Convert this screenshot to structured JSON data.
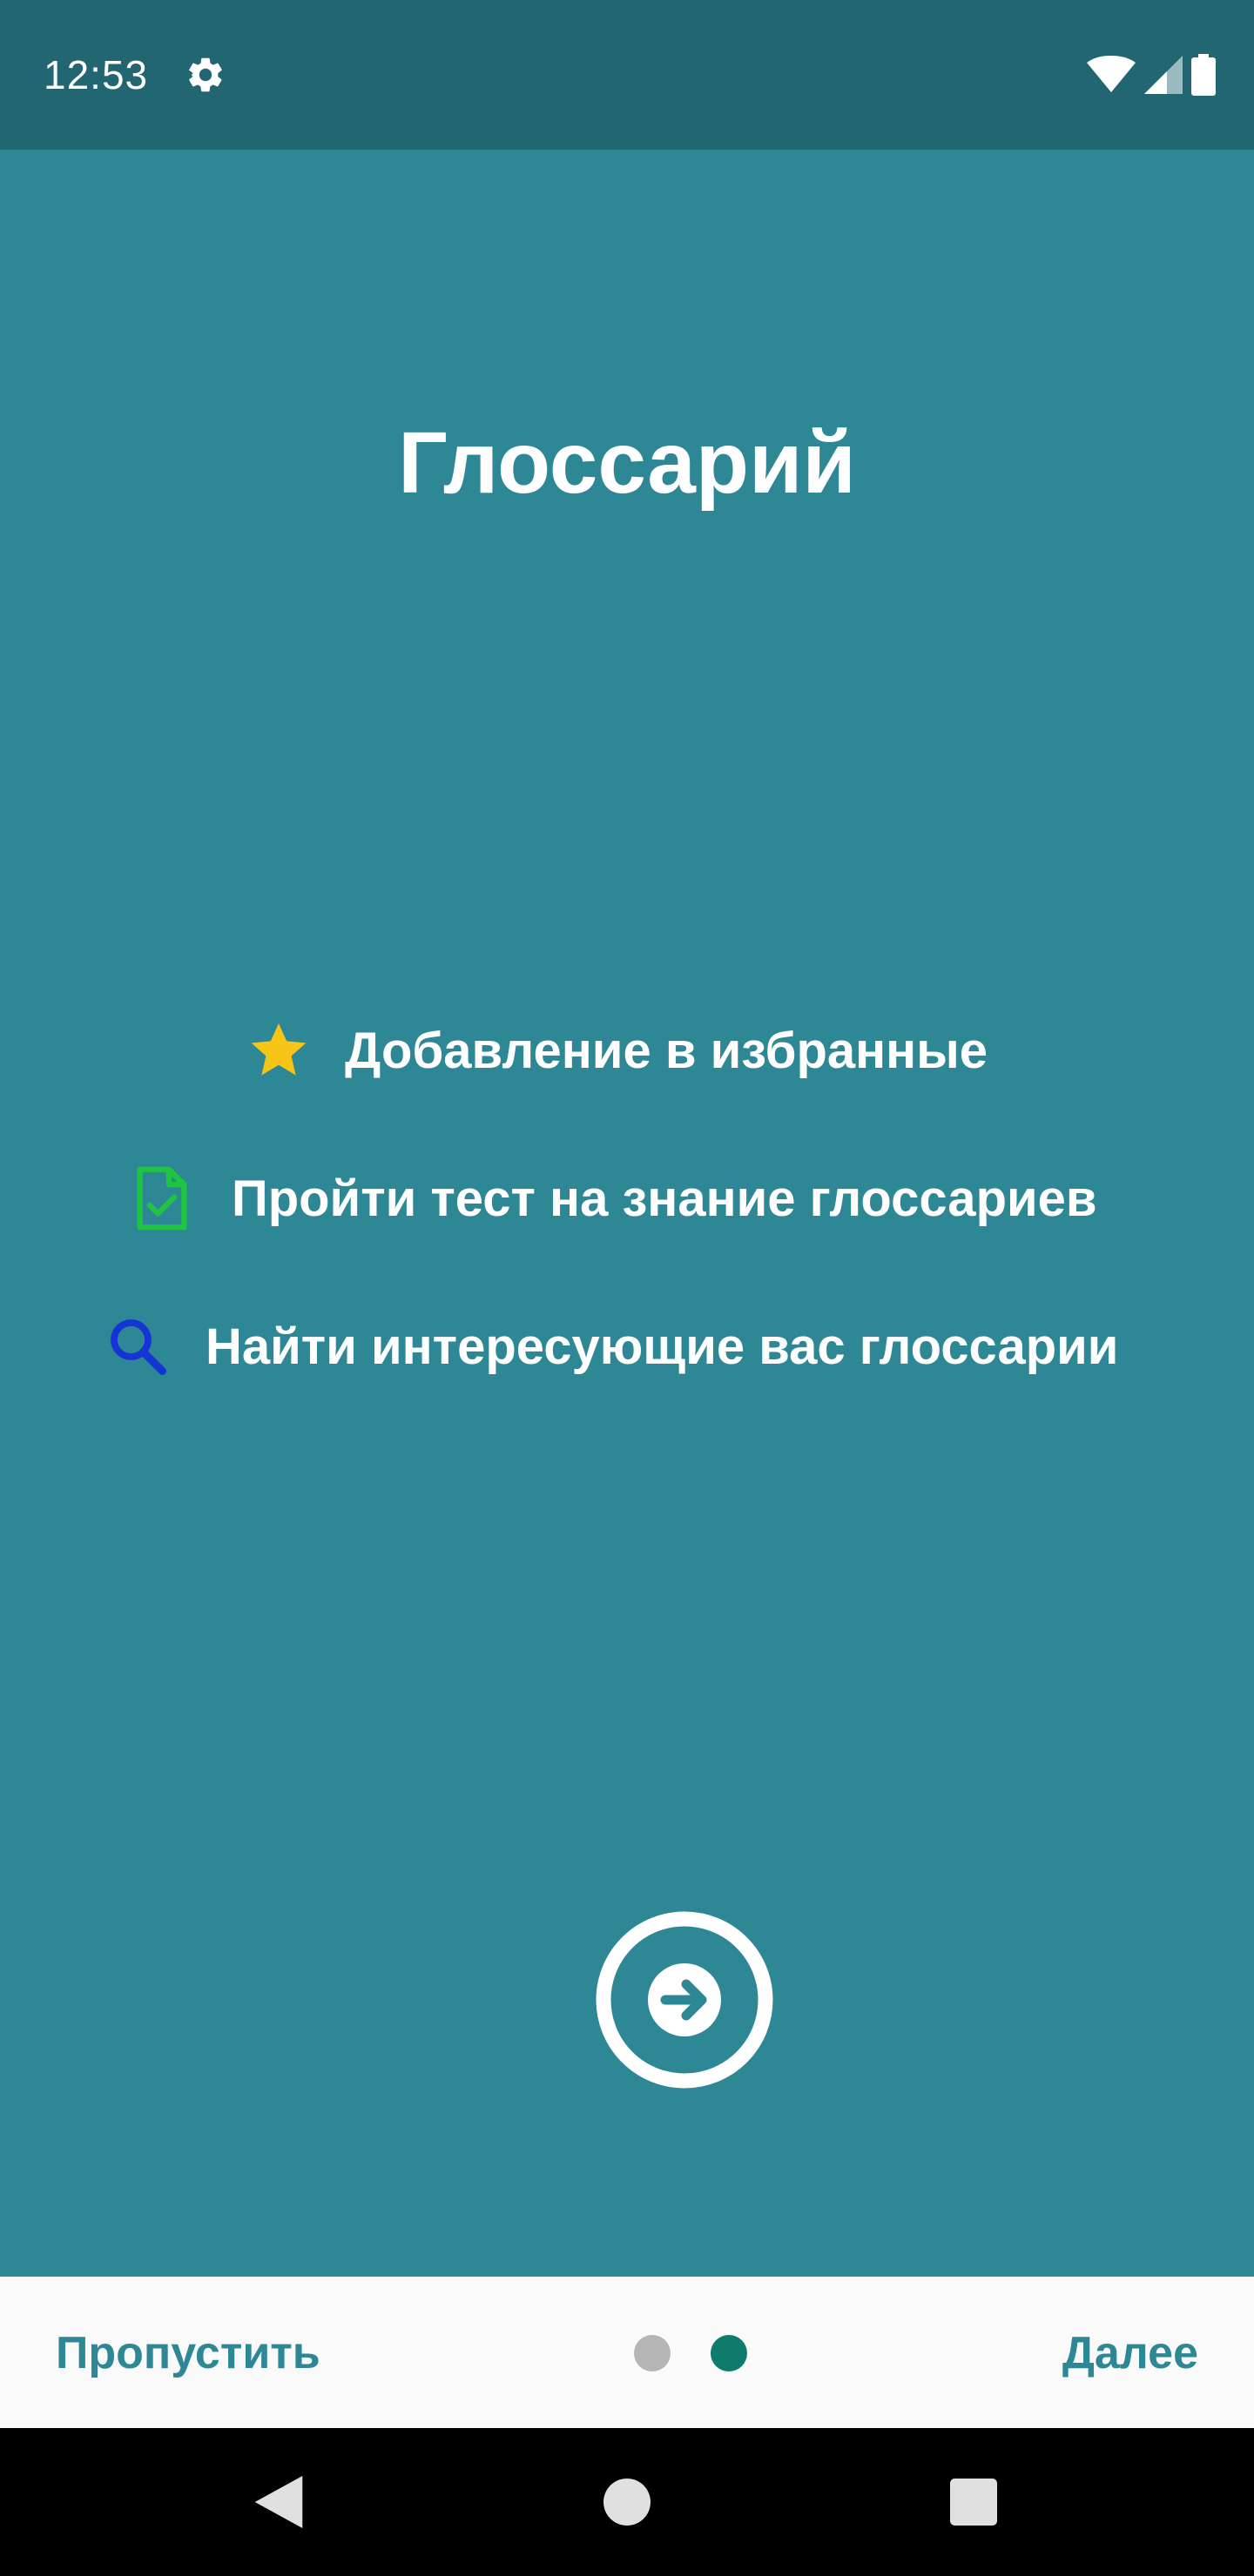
{
  "status_bar": {
    "time": "12:53",
    "icons": [
      "settings-gear-icon",
      "wifi-icon",
      "cell-signal-icon",
      "battery-icon"
    ]
  },
  "onboarding": {
    "title": "Глоссарий",
    "features": [
      {
        "icon": "star-icon",
        "icon_color": "#F5C518",
        "label": "Добавление в избранные"
      },
      {
        "icon": "document-check-icon",
        "icon_color": "#1FC441",
        "label": "Пройти тест на знание глоссариев"
      },
      {
        "icon": "search-icon",
        "icon_color": "#1534D6",
        "label": "Найти интересующие вас глоссарии"
      }
    ],
    "next_icon": "arrow-right-circle-icon"
  },
  "bottom_bar": {
    "skip_label": "Пропустить",
    "next_label": "Далее",
    "pager": {
      "total": 2,
      "current": 2
    }
  },
  "nav_bar": {
    "icons": [
      "back-icon",
      "home-icon",
      "recents-icon"
    ]
  },
  "colors": {
    "background": "#2E8795",
    "status_bar": "#226671",
    "bottom_bar": "#FAFAFA",
    "accent_text": "#2E8795",
    "dot_active": "#0F7B6C",
    "dot_inactive": "#B5B5B5"
  }
}
